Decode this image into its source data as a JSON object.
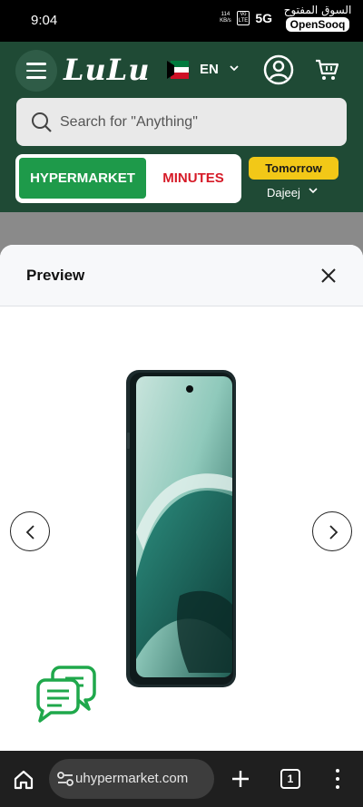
{
  "status_bar": {
    "time": "9:04",
    "net_speed_value": "114",
    "net_speed_unit": "KB/s",
    "volte_top": "Vo",
    "volte_bottom": "LTE",
    "network": "5G",
    "watermark_arabic": "السوق المفتوح",
    "watermark_english": "OpenSooq"
  },
  "header": {
    "logo": "LuLu",
    "language": "EN",
    "flag_colors": [
      "#007a3d",
      "#ffffff",
      "#ce1126",
      "#000000"
    ],
    "search_placeholder": "Search for \"Anything\"",
    "mode_hypermarket": "HYPERMARKET",
    "mode_minutes": "MINUTES",
    "delivery_slot": "Tomorrow",
    "location": "Dajeej",
    "colors": {
      "brand": "#1f4a35",
      "active": "#1e9a4a",
      "minutes": "#d61a27",
      "badge": "#f2c817"
    }
  },
  "modal": {
    "title": "Preview"
  },
  "browser": {
    "url": "luluhypermarket.com",
    "tab_count": "1"
  }
}
